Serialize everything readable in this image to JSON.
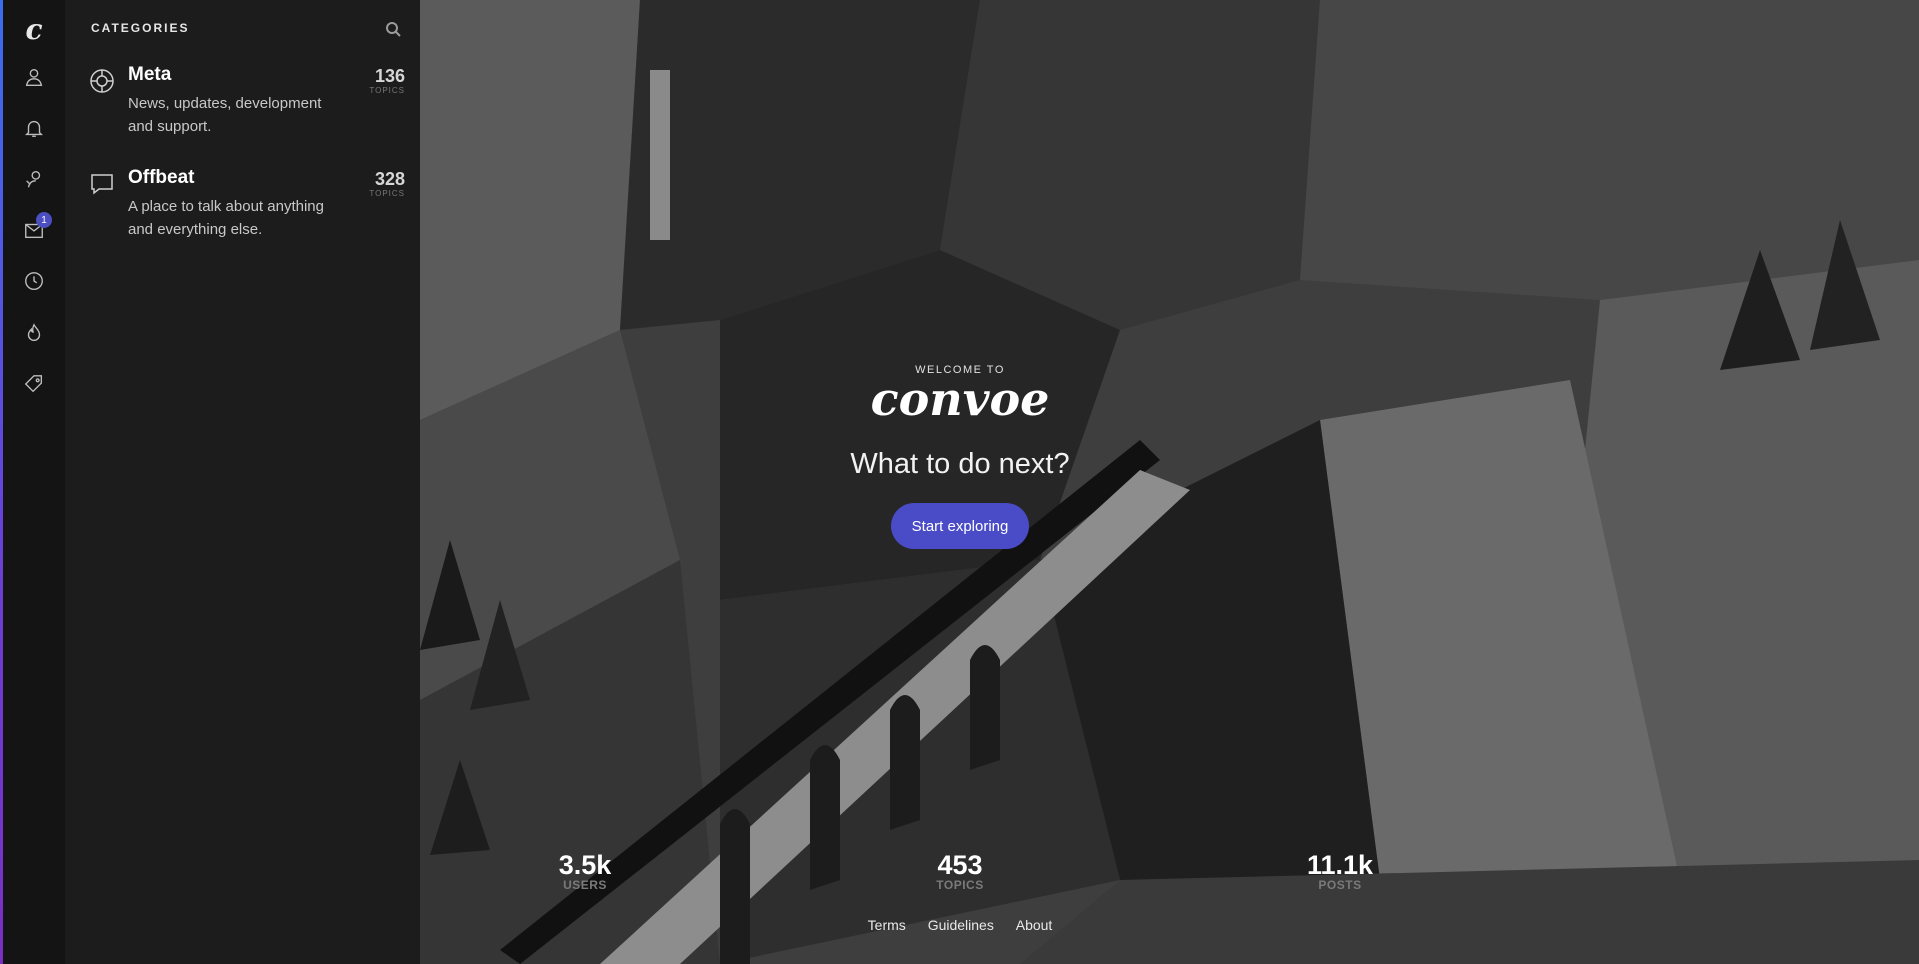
{
  "rail": {
    "logo": "c",
    "items": [
      {
        "icon": "user-icon"
      },
      {
        "icon": "bell-icon"
      },
      {
        "icon": "users-icon"
      },
      {
        "icon": "inbox-icon",
        "badge": "1"
      },
      {
        "icon": "clock-icon"
      },
      {
        "icon": "flame-icon"
      },
      {
        "icon": "tag-icon"
      }
    ]
  },
  "panel": {
    "title": "CATEGORIES",
    "categories": [
      {
        "name": "Meta",
        "description": "News, updates, development and support.",
        "count": "136",
        "count_label": "TOPICS",
        "icon": "lifebuoy-icon"
      },
      {
        "name": "Offbeat",
        "description": "A place to talk about anything and everything else.",
        "count": "328",
        "count_label": "TOPICS",
        "icon": "chat-icon"
      }
    ]
  },
  "hero": {
    "welcome": "WELCOME TO",
    "brand": "convoe",
    "tagline": "What to do next?",
    "cta": "Start exploring",
    "stats": [
      {
        "value": "3.5k",
        "label": "USERS"
      },
      {
        "value": "453",
        "label": "TOPICS"
      },
      {
        "value": "11.1k",
        "label": "POSTS"
      }
    ],
    "footer_links": [
      "Terms",
      "Guidelines",
      "About"
    ]
  },
  "colors": {
    "accent": "#4a4cc7",
    "panel": "#1c1c1c",
    "rail": "#141414"
  }
}
